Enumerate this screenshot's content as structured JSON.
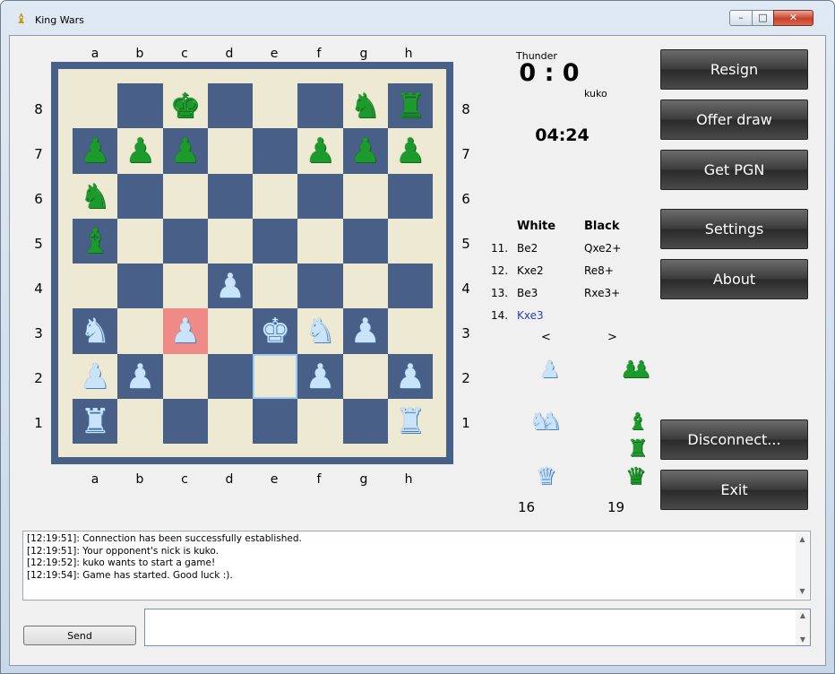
{
  "window": {
    "title": "King Wars",
    "minimize": "–",
    "maximize": "□",
    "close": "✕"
  },
  "board": {
    "files": [
      "a",
      "b",
      "c",
      "d",
      "e",
      "f",
      "g",
      "h"
    ],
    "ranks": [
      "8",
      "7",
      "6",
      "5",
      "4",
      "3",
      "2",
      "1"
    ],
    "light_color": "#ede9d2",
    "dark_color": "#485f88",
    "last_move_color": "#f08a86",
    "squares": [
      [
        null,
        null,
        "bk",
        null,
        null,
        null,
        "bn",
        "br"
      ],
      [
        "bp",
        "bp",
        "bp",
        null,
        null,
        "bp",
        "bp",
        "bp"
      ],
      [
        "bn",
        null,
        null,
        null,
        null,
        null,
        null,
        null
      ],
      [
        "bb",
        null,
        null,
        null,
        null,
        null,
        null,
        null
      ],
      [
        null,
        null,
        null,
        "wp",
        null,
        null,
        null,
        null
      ],
      [
        "wn",
        null,
        "wp",
        null,
        "wk",
        "wn",
        "wp",
        null
      ],
      [
        "wp",
        "wp",
        null,
        null,
        null,
        "wp",
        null,
        "wp"
      ],
      [
        "wr",
        null,
        null,
        null,
        null,
        null,
        null,
        "wr"
      ]
    ],
    "highlight_prev": "c3",
    "highlight_sel": "e2"
  },
  "players": {
    "white_name": "Thunder",
    "black_name": "kuko",
    "score": "0 : 0",
    "clock": "04:24"
  },
  "moves": {
    "header_white": "White",
    "header_black": "Black",
    "rows": [
      {
        "num": "11.",
        "white": "Be2",
        "black": "Qxe2+"
      },
      {
        "num": "12.",
        "white": "Kxe2",
        "black": "Re8+"
      },
      {
        "num": "13.",
        "white": "Be3",
        "black": "Rxe3+"
      },
      {
        "num": "14.",
        "white": "Kxe3",
        "black": ""
      }
    ],
    "prev": "<",
    "next": ">"
  },
  "captured": {
    "white_count": "16",
    "black_count": "19"
  },
  "buttons": {
    "resign": "Resign",
    "offer_draw": "Offer draw",
    "get_pgn": "Get PGN",
    "settings": "Settings",
    "about": "About",
    "disconnect": "Disconnect...",
    "exit": "Exit"
  },
  "log": [
    "[12:19:51]: Connection has been successfully established.",
    "[12:19:51]: Your opponent's nick is kuko.",
    "[12:19:52]: kuko wants to start a game!",
    "[12:19:54]: Game has started. Good luck :)."
  ],
  "chat": {
    "send_label": "Send",
    "input_value": ""
  }
}
